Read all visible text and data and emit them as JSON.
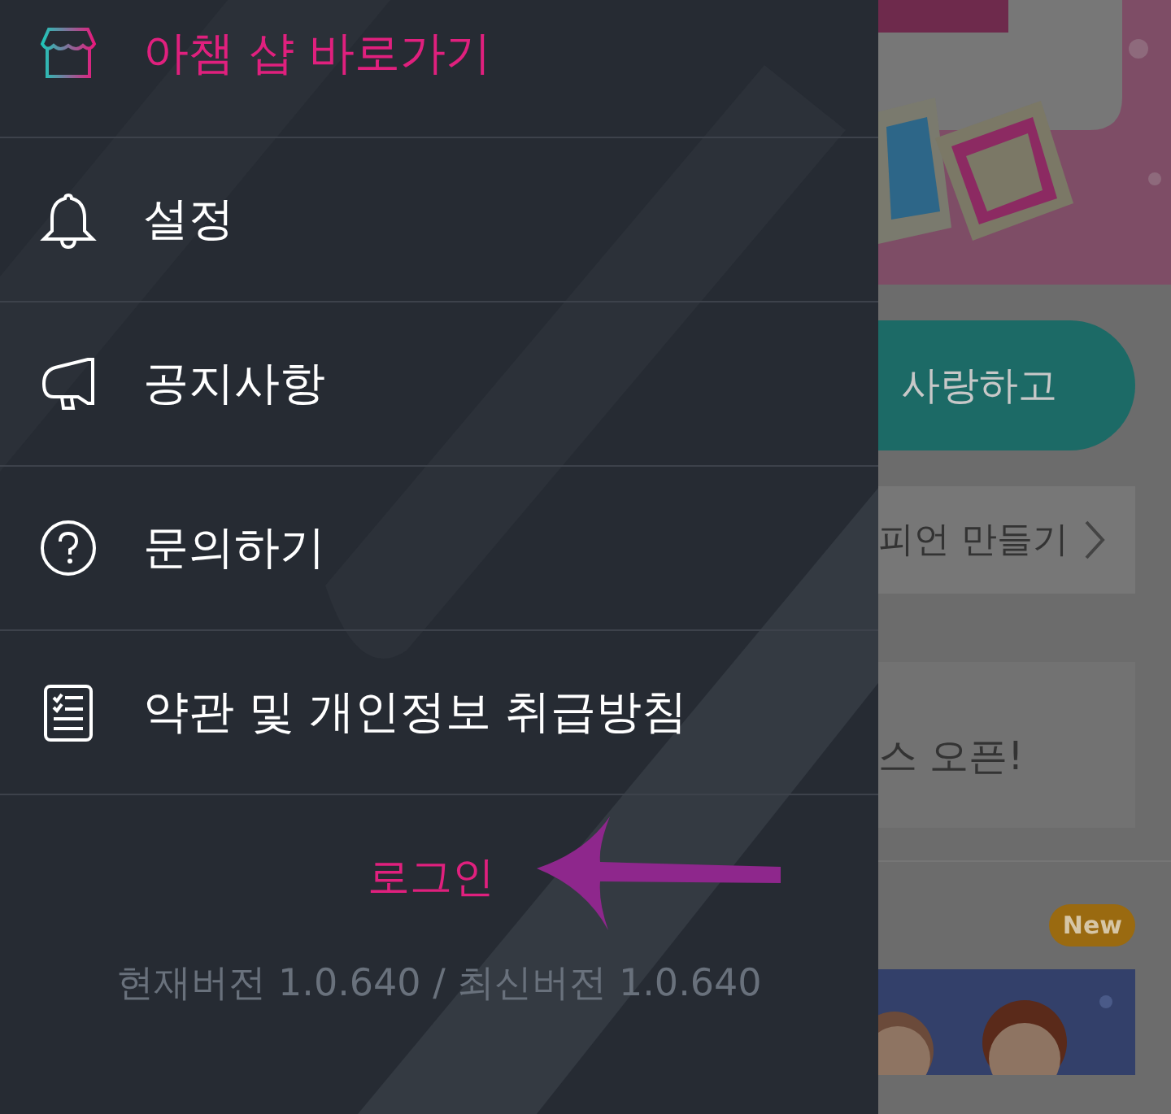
{
  "menu": [
    {
      "kind": "shop",
      "label": "아챔 샵 바로가기",
      "highlighted": true
    },
    {
      "kind": "bell",
      "label": "설정",
      "highlighted": false
    },
    {
      "kind": "megaphone",
      "label": "공지사항",
      "highlighted": false
    },
    {
      "kind": "question",
      "label": "문의하기",
      "highlighted": false
    },
    {
      "kind": "document",
      "label": "약관 및 개인정보 취급방침",
      "highlighted": false
    }
  ],
  "login": "로그인",
  "version": "현재버전 1.0.640 / 최신버전 1.0.640",
  "background_page": {
    "pill_button": "사랑하고",
    "card_link": "피언 만들기",
    "notice": "스 오픈!",
    "badge": "New"
  }
}
